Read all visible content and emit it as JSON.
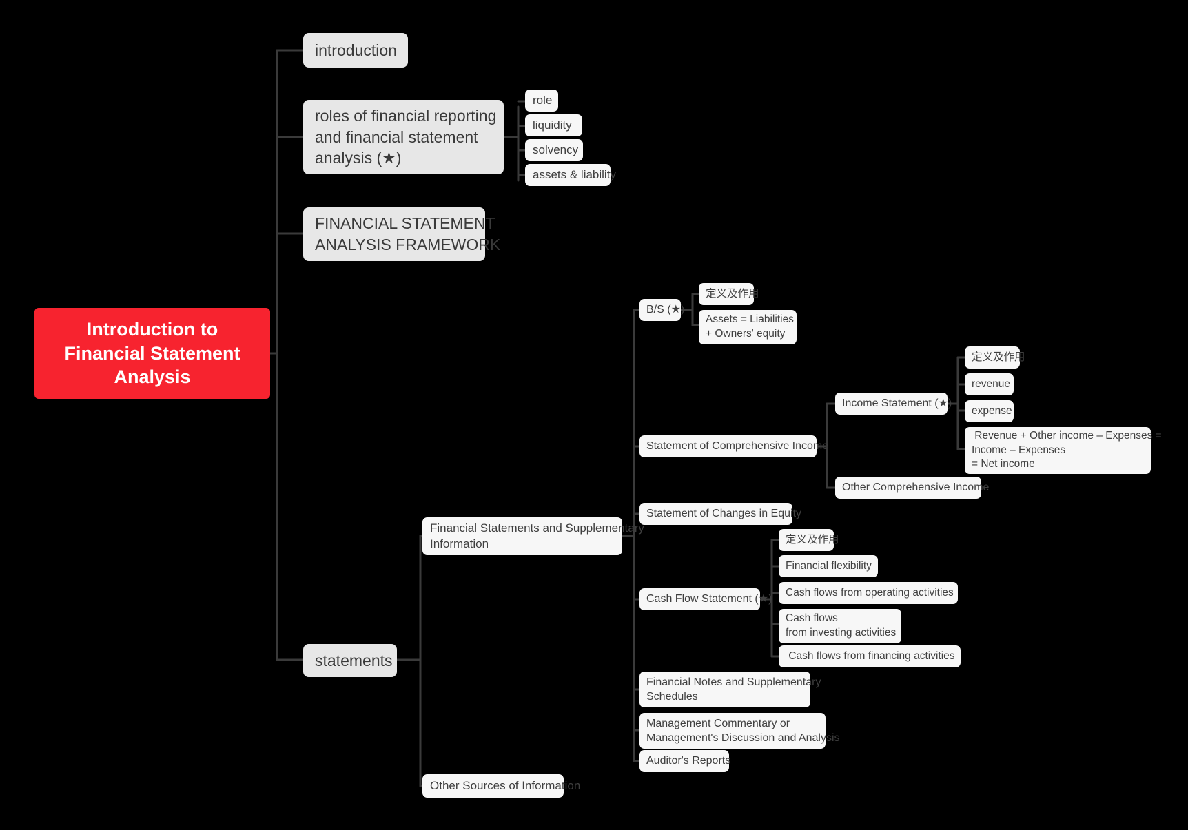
{
  "diagram": {
    "type": "mind-map",
    "background_color": "#000000",
    "root_color": "#F7232F",
    "branch_color": "#3a3a3a",
    "node_fill_level1": "#e7e7e7",
    "node_fill_leaf": "#f7f7f7",
    "text_color": "#3f3f3f"
  },
  "root": {
    "label": "Introduction to\nFinancial Statement\nAnalysis"
  },
  "nodes": {
    "introduction": "introduction",
    "roles": "roles of financial reporting\nand financial statement\nanalysis (★)",
    "roles_children": {
      "role": "role",
      "liquidity": "liquidity",
      "solvency": "solvency",
      "assets_liability": "assets & liability"
    },
    "framework": "FINANCIAL STATEMENT\nANALYSIS FRAMEWORK",
    "statements": "statements",
    "statements_children": {
      "fs_supplementary": "Financial Statements and Supplementary\nInformation",
      "other_sources": "Other Sources of Information"
    },
    "fs_children": {
      "balance_sheet": "B/S (★)",
      "comprehensive_income": "Statement of Comprehensive Income",
      "changes_in_equity": "Statement of Changes in Equity",
      "cash_flow": "Cash Flow Statement (★)",
      "financial_notes": "Financial Notes and Supplementary\nSchedules",
      "management_commentary": "Management Commentary or\nManagement's Discussion and Analysis",
      "auditors_reports": "Auditor's Reports"
    },
    "balance_sheet_children": {
      "definition": "定义及作用",
      "equation": "Assets = Liabilities\n+ Owners' equity"
    },
    "comprehensive_income_children": {
      "income_statement": "Income Statement (★)",
      "other_comprehensive_income": "Other Comprehensive Income"
    },
    "income_statement_children": {
      "definition": "定义及作用",
      "revenue": "revenue",
      "expense": "expense",
      "formula": " Revenue + Other income – Expenses =\nIncome – Expenses\n= Net income"
    },
    "cash_flow_children": {
      "definition": "定义及作用",
      "financial_flexibility": "Financial flexibility",
      "operating": "Cash flows from operating activities",
      "investing": "Cash flows\nfrom investing activities",
      "financing": " Cash flows from financing activities"
    }
  }
}
